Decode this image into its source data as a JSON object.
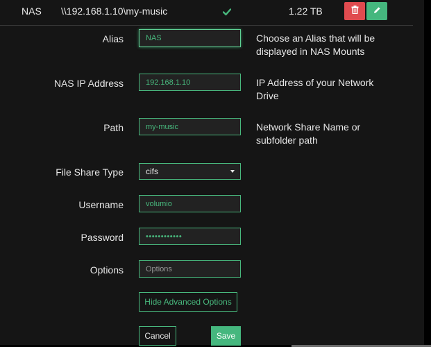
{
  "mount": {
    "name": "NAS",
    "path": "\\\\192.168.1.10\\my-music",
    "status_icon": "check-icon",
    "size": "1.22 TB",
    "delete_icon": "trash-icon",
    "edit_icon": "pencil-icon",
    "colors": {
      "delete": "#e04b4f",
      "edit": "#45b77e",
      "accent": "#48b87d"
    }
  },
  "form": {
    "alias": {
      "label": "Alias",
      "value": "NAS",
      "help": "Choose an Alias that will be displayed in NAS Mounts"
    },
    "ip": {
      "label": "NAS IP Address",
      "value": "192.168.1.10",
      "help": "IP Address of your Network Drive"
    },
    "path": {
      "label": "Path",
      "value": "my-music",
      "help": "Network Share Name or subfolder path"
    },
    "fstype": {
      "label": "File Share Type",
      "value": "cifs"
    },
    "username": {
      "label": "Username",
      "value": "volumio"
    },
    "password": {
      "label": "Password",
      "value": "••••••••••••"
    },
    "options": {
      "label": "Options",
      "placeholder": "Options",
      "value": ""
    },
    "advanced_button": "Hide Advanced Options",
    "cancel_button": "Cancel",
    "save_button": "Save"
  }
}
